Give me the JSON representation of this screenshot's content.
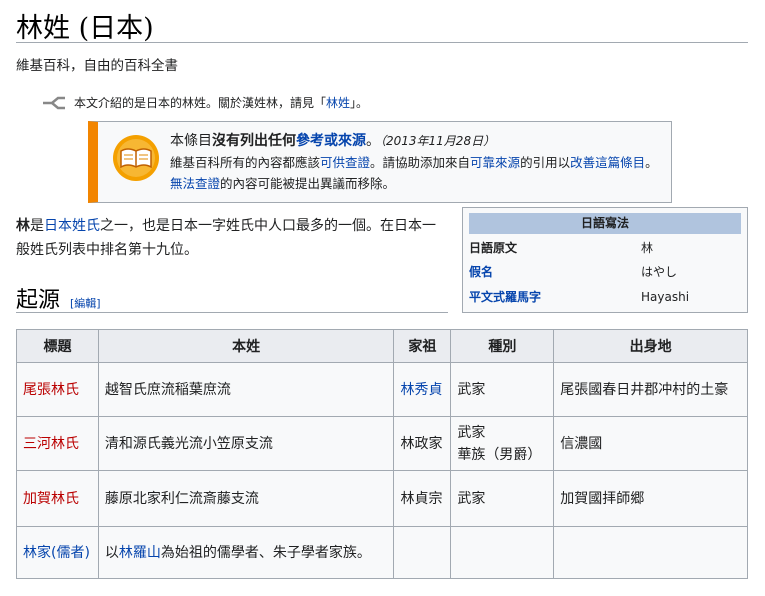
{
  "page": {
    "title": "林姓 (日本)",
    "subtitle": "維基百科，自由的百科全書"
  },
  "hatnote": {
    "text_before": "本文介紹的是日本的林姓。關於漢姓林，請見「",
    "link": "林姓",
    "text_after": "」。"
  },
  "ambox": {
    "line1_pre": "本條目",
    "line1_bold": "沒有列出任何",
    "line1_link": "參考或來源",
    "line1_end": "。",
    "date": "（2013年11月28日）",
    "l2_a": "維基百科所有的內容都應該",
    "l2_link1": "可供查證",
    "l2_b": "。請協助添加來自",
    "l2_link2": "可靠來源",
    "l2_c": "的引用以",
    "l2_link3": "改善這篇條目",
    "l2_d": "。",
    "l2_link4": "無法查證",
    "l2_e": "的內容可能被提出異議而移除。"
  },
  "lead": {
    "bold": "林",
    "a": "是",
    "link": "日本姓氏",
    "b": "之一，也是日本一字姓氏中人口最多的一個。在日本一般姓氏列表中排名第十九位。"
  },
  "infobox": {
    "title": "日語寫法",
    "rows": [
      {
        "key": "日語原文",
        "value": "林",
        "key_is_link": false
      },
      {
        "key": "假名",
        "value": "はやし",
        "key_is_link": true
      },
      {
        "key": "平文式羅馬字",
        "value": "Hayashi",
        "key_is_link": true
      }
    ]
  },
  "section": {
    "title": "起源",
    "edit": "[編輯]"
  },
  "table": {
    "headers": [
      "標題",
      "本姓",
      "家祖",
      "種別",
      "出身地"
    ],
    "rows": [
      {
        "title": "尾張林氏",
        "origin": "越智氏庶流稲葉庶流",
        "founder": "林秀貞",
        "type": "武家",
        "birthplace": "尾張國春日井郡冲村的土豪"
      },
      {
        "title": "三河林氏",
        "origin": "清和源氏義光流小笠原支流",
        "founder": "林政家",
        "type": "武家\n華族（男爵）",
        "birthplace": "信濃國"
      },
      {
        "title": "加賀林氏",
        "origin": "藤原北家利仁流斎藤支流",
        "founder": "林貞宗",
        "type": "武家",
        "birthplace": "加賀國拝師郷"
      },
      {
        "title": "林家(儒者)",
        "origin_pre": "以",
        "origin_link": "林羅山",
        "origin_post": "為始祖的儒學者、朱子學者家族。",
        "founder": "",
        "type": "",
        "birthplace": ""
      }
    ]
  },
  "colors": {
    "link": "#0645ad",
    "redlink": "#ba0000",
    "ambox_border": "#f28500",
    "infobox_header": "#b0c4de"
  }
}
